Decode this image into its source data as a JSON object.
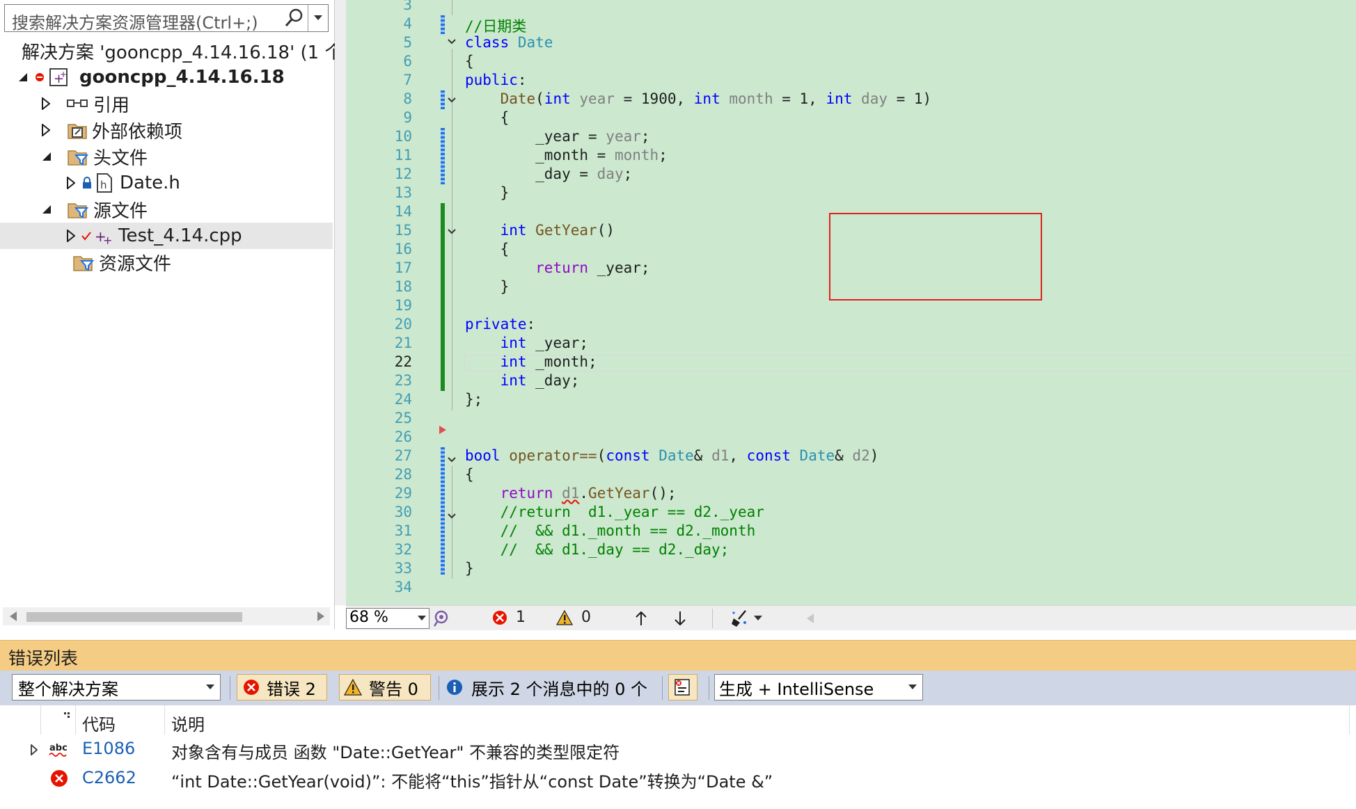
{
  "explorer": {
    "search_placeholder": "搜索解决方案资源管理器(Ctrl+;)",
    "solution_label": "解决方案 'gooncpp_4.14.16.18' (1 个",
    "project_label": "gooncpp_4.14.16.18",
    "references_label": "引用",
    "external_deps_label": "外部依赖项",
    "headers_label": "头文件",
    "header_file_label": "Date.h",
    "sources_label": "源文件",
    "source_file_label": "Test_4.14.cpp",
    "resources_label": "资源文件"
  },
  "editor": {
    "current_line": "22",
    "line_numbers": [
      "3",
      "4",
      "5",
      "6",
      "7",
      "8",
      "9",
      "10",
      "11",
      "12",
      "13",
      "14",
      "15",
      "16",
      "17",
      "18",
      "19",
      "20",
      "21",
      "22",
      "23",
      "24",
      "25",
      "26",
      "27",
      "28",
      "29",
      "30",
      "31",
      "32",
      "33",
      "34"
    ]
  },
  "status": {
    "zoom": "68 %",
    "error_count": "1",
    "warning_count": "0"
  },
  "error_list": {
    "title": "错误列表",
    "scope_value": "整个解决方案",
    "errors_toggle": "错误 2",
    "warnings_toggle": "警告 0",
    "messages_toggle": "展示 2 个消息中的 0 个",
    "build_filter_value": "生成 + IntelliSense",
    "col_code": "代码",
    "col_description": "说明",
    "rows": [
      {
        "code": "E1086",
        "description": "对象含有与成员 函数 \"Date::GetYear\" 不兼容的类型限定符"
      },
      {
        "code": "C2662",
        "description": "“int Date::GetYear(void)”: 不能将“this”指针从“const Date”转换为“Date &”"
      }
    ]
  }
}
